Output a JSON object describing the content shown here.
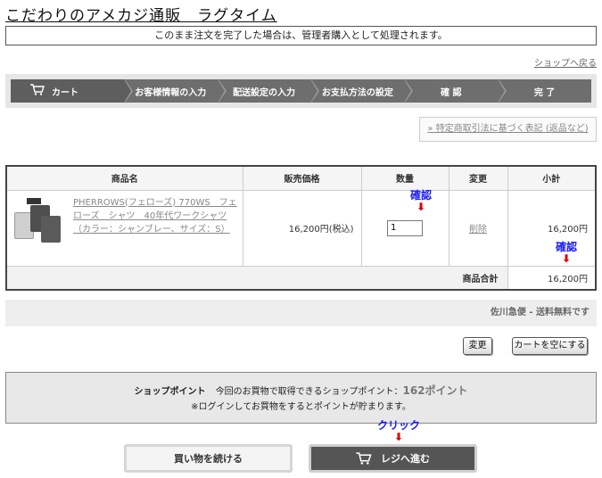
{
  "header": {
    "site_title": "こだわりのアメカジ通販　ラグタイム",
    "notice": "このまま注文を完了した場合は、管理者購入として処理されます。",
    "back_link": "ショップへ戻る"
  },
  "steps": [
    "カート",
    "お客様情報の入力",
    "配送設定の入力",
    "お支払方法の設定",
    "確 認",
    "完 了"
  ],
  "legal_link": "» 特定商取引法に基づく表記 (返品など)",
  "table": {
    "headers": [
      "商品名",
      "販売価格",
      "数量",
      "変更",
      "小計"
    ],
    "item": {
      "name": "PHERROWS(フェローズ) 770WS　フェローズ　シャツ　40年代ワークシャツ（カラー：シャンブレー、サイズ：S）",
      "price": "16,200円(税込)",
      "qty": "1",
      "delete_label": "削除",
      "subtotal": "16,200円"
    },
    "total_label": "商品合計",
    "total_value": "16,200円"
  },
  "annotations": {
    "confirm1": "確認",
    "confirm2": "確認",
    "click": "クリック"
  },
  "shipping": "佐川急便 - 送料無料です",
  "buttons": {
    "update": "変更",
    "empty_cart": "カートを空にする",
    "continue": "買い物を続ける",
    "checkout": "レジへ進む"
  },
  "points": {
    "label": "ショップポイント",
    "text": "今回のお買物で取得できるショップポイント：",
    "value": "162ポイント",
    "note": "※ログインしてお買物をするとポイントが貯まります。"
  },
  "colors": {
    "annotation_text": "#1a1aff",
    "annotation_arrow": "#e00000",
    "step_bg": "#6e6e6e"
  }
}
